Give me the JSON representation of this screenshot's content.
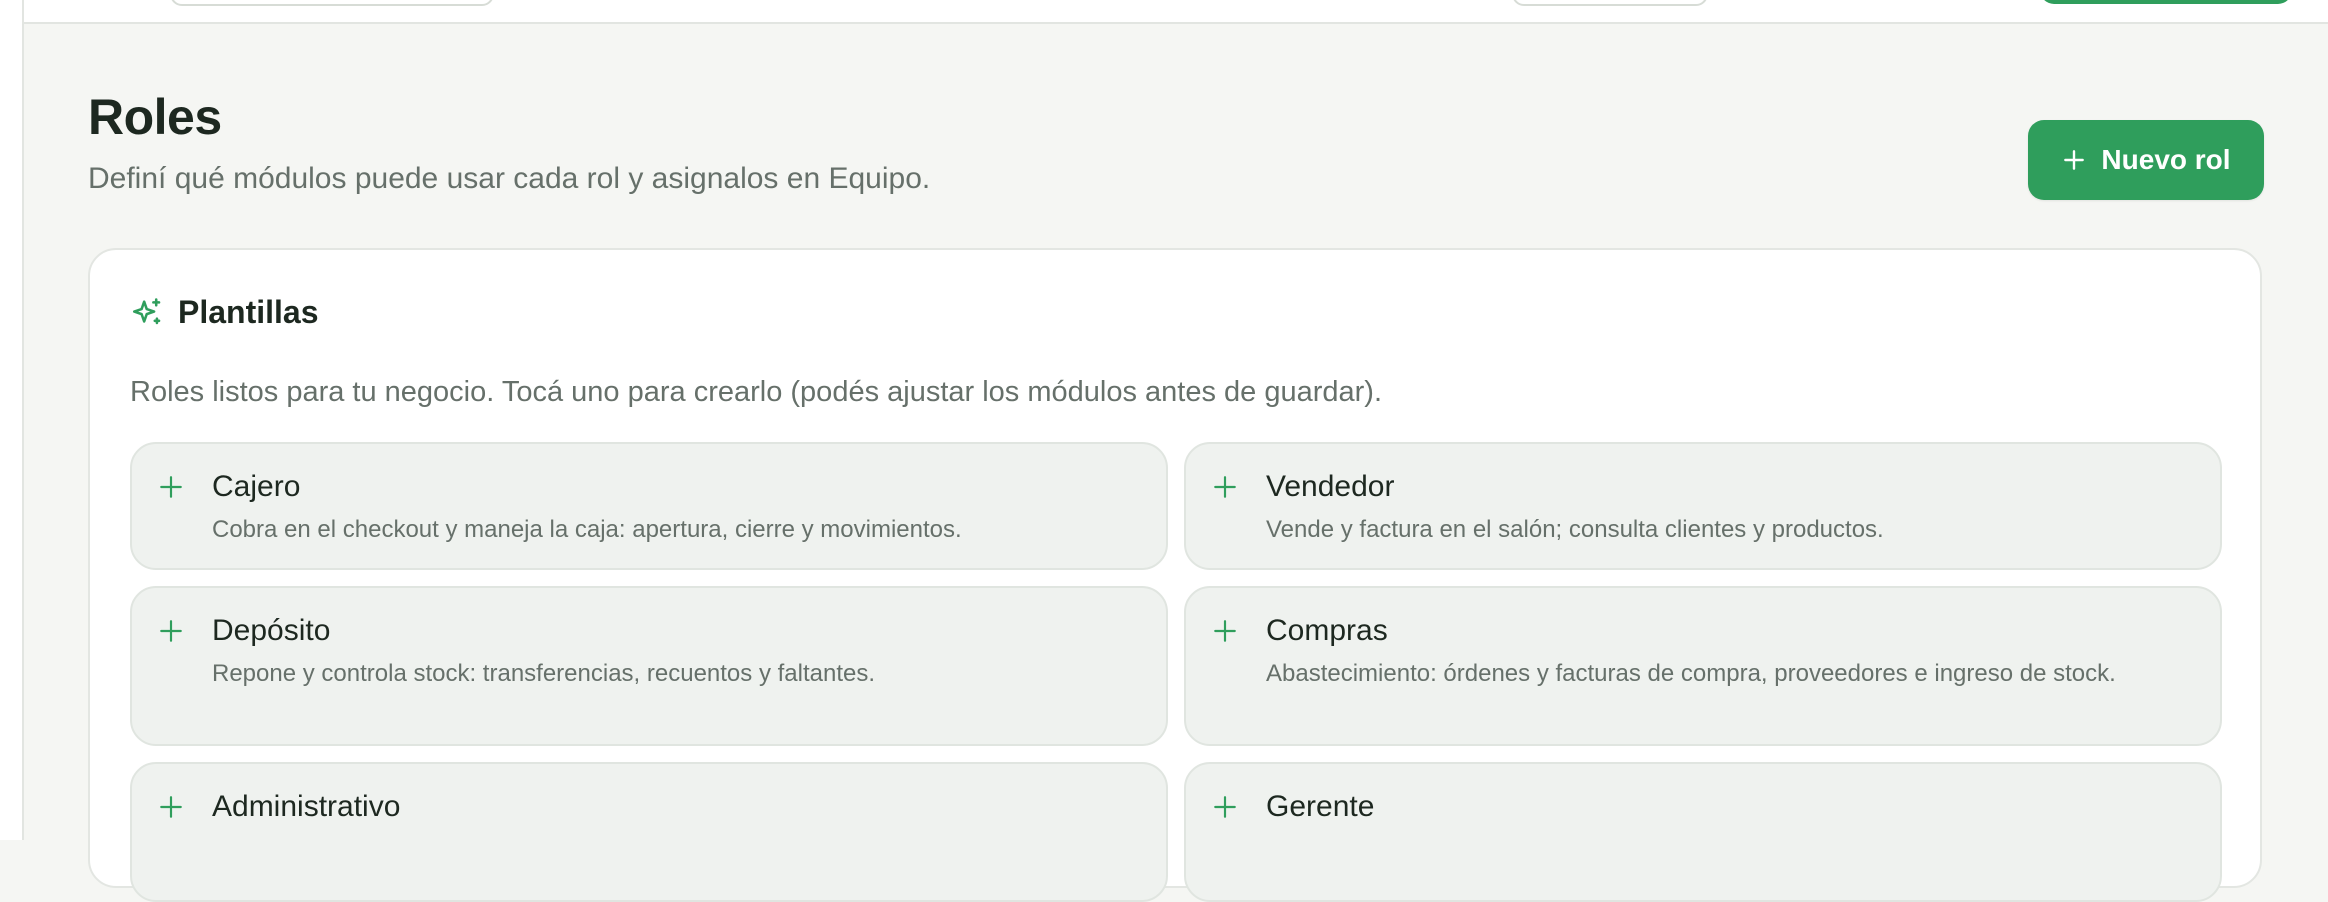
{
  "header": {
    "title": "Roles",
    "subtitle": "Definí qué módulos puede usar cada rol y asignalos en Equipo.",
    "new_role_label": "Nuevo rol"
  },
  "templates": {
    "title": "Plantillas",
    "description": "Roles listos para tu negocio. Tocá uno para crearlo (podés ajustar los módulos antes de guardar).",
    "items": [
      {
        "name": "Cajero",
        "description": "Cobra en el checkout y maneja la caja: apertura, cierre y movimientos."
      },
      {
        "name": "Vendedor",
        "description": "Vende y factura en el salón; consulta clientes y productos."
      },
      {
        "name": "Depósito",
        "description": "Repone y controla stock: transferencias, recuentos y faltantes."
      },
      {
        "name": "Compras",
        "description": "Abastecimiento: órdenes y facturas de compra, proveedores e ingreso de stock."
      },
      {
        "name": "Administrativo",
        "description": ""
      },
      {
        "name": "Gerente",
        "description": ""
      }
    ]
  },
  "colors": {
    "accent": "#2f9e5c",
    "background": "#f5f6f3",
    "card": "#ffffff",
    "template_bg": "#eff2ef",
    "text": "#1d2820",
    "muted": "#66706a"
  },
  "icons": {
    "new_role": "plus-icon",
    "templates": "sparkles-icon",
    "template_item": "plus-icon"
  }
}
